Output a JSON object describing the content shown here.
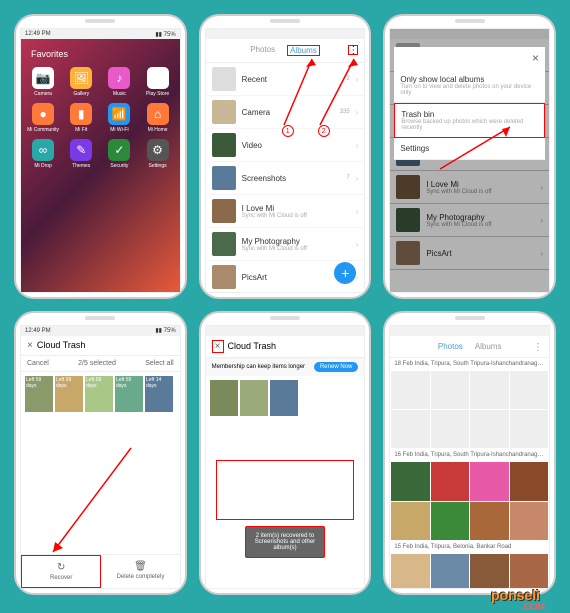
{
  "p1": {
    "title": "Favorites",
    "apps": [
      {
        "label": "Camera",
        "bg": "#fff",
        "glyph": "📷"
      },
      {
        "label": "Gallery",
        "bg": "#ffb03a",
        "glyph": "🖼"
      },
      {
        "label": "Music",
        "bg": "#e85ac9",
        "glyph": "♪"
      },
      {
        "label": "Play Store",
        "bg": "#fff",
        "glyph": "▶"
      },
      {
        "label": "Mi Community",
        "bg": "#ff7a3a",
        "glyph": "●"
      },
      {
        "label": "Mi Fit",
        "bg": "#ff7a3a",
        "glyph": "▮"
      },
      {
        "label": "Mi Wi-Fi",
        "bg": "#2196f3",
        "glyph": "📶"
      },
      {
        "label": "Mi Home",
        "bg": "#ff7a3a",
        "glyph": "⌂"
      },
      {
        "label": "Mi Drop",
        "bg": "#2aa8a8",
        "glyph": "∞"
      },
      {
        "label": "Themes",
        "bg": "#7a3ae8",
        "glyph": "✎"
      },
      {
        "label": "Security",
        "bg": "#2a8a3a",
        "glyph": "✓"
      },
      {
        "label": "Settings",
        "bg": "#555",
        "glyph": "⚙"
      }
    ]
  },
  "p2": {
    "tabs": [
      "Photos",
      "Albums"
    ],
    "active": 1,
    "markers": [
      "1",
      "2"
    ],
    "albums": [
      {
        "name": "Recent",
        "sub": "",
        "count": "2"
      },
      {
        "name": "Camera",
        "sub": "",
        "count": "335"
      },
      {
        "name": "Video",
        "sub": "",
        "count": ""
      },
      {
        "name": "Screenshots",
        "sub": "",
        "count": "7"
      },
      {
        "name": "I Love Mi",
        "sub": "Sync with Mi Cloud is off",
        "count": ""
      },
      {
        "name": "My Photography",
        "sub": "Sync with Mi Cloud is off",
        "count": ""
      },
      {
        "name": "PicsArt",
        "sub": "",
        "count": ""
      }
    ]
  },
  "p3": {
    "close": "×",
    "items": [
      {
        "title": "Only show local albums",
        "sub": "Turn on to view and delete photos on your device only"
      },
      {
        "title": "Trash bin",
        "sub": "Browse backed up photos which were deleted recently",
        "hl": true
      },
      {
        "title": "Settings",
        "sub": ""
      }
    ]
  },
  "p4": {
    "title": "Cloud Trash",
    "cancel": "Cancel",
    "selected": "2/5 selected",
    "selectall": "Select all",
    "items": [
      {
        "label": "Left 59 days"
      },
      {
        "label": "Left 59 days"
      },
      {
        "label": "Left 59 days"
      },
      {
        "label": "Left 59 days"
      },
      {
        "label": "Left 14 days"
      }
    ],
    "recover": "Recover",
    "delete": "Delete completely"
  },
  "p5": {
    "title": "Cloud Trash",
    "banner": "Membership can keep items longer",
    "renew": "Renew Now",
    "toast": "2 item(s) recovered to Screenshots and other album(s)"
  },
  "p6": {
    "tabs": [
      "Photos",
      "Albums"
    ],
    "active": 0,
    "sections": [
      {
        "date": "18 Feb  India, Tripura, South Tripura-Ishanchandranagar and Bel...",
        "cells": 8
      },
      {
        "date": "16 Feb  India, Tripura, South Tripura-Ishanchandranagar and Bel...",
        "cells": 8
      },
      {
        "date": "15 Feb  India, Tripura, Belonia, Bankar Road",
        "cells": 4
      }
    ]
  },
  "status": {
    "time": "12:49 PM",
    "right": "▮▮ 75%"
  },
  "brand1": "ponseli",
  "brand2": ".COM"
}
